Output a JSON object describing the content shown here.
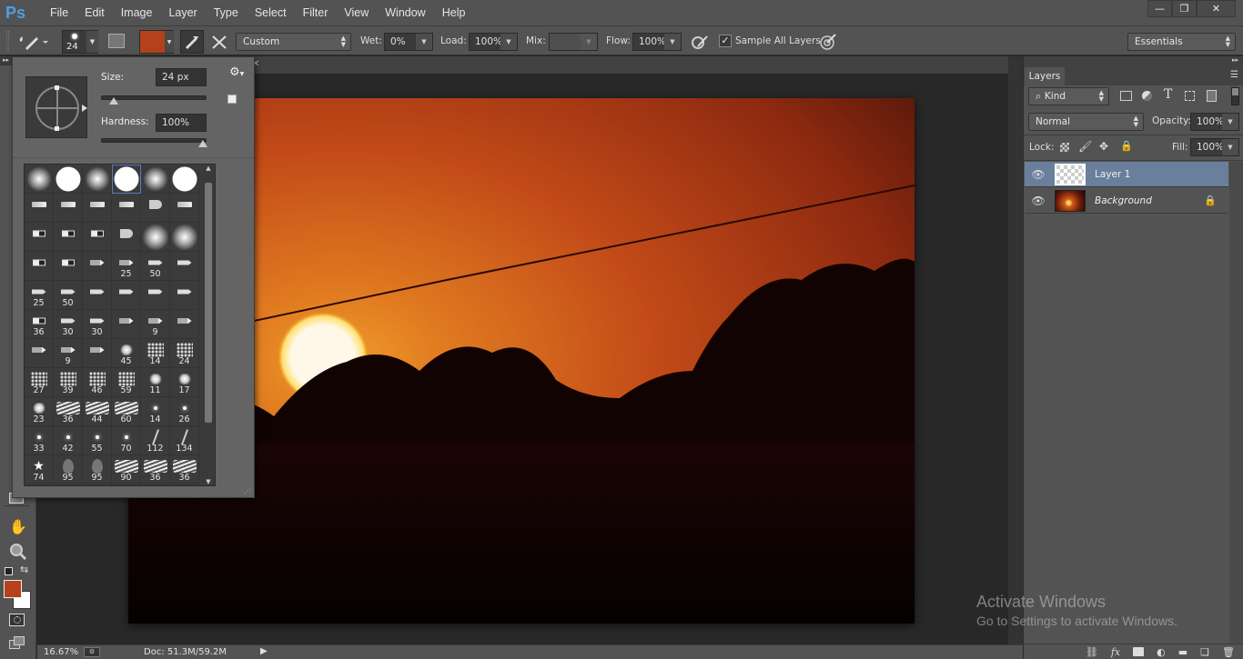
{
  "app": {
    "logo": "Ps"
  },
  "menu": [
    "File",
    "Edit",
    "Image",
    "Layer",
    "Type",
    "Select",
    "Filter",
    "View",
    "Window",
    "Help"
  ],
  "window_controls": {
    "minimize": "—",
    "restore": "❐",
    "close": "✕"
  },
  "options_bar": {
    "brush_size": "24",
    "foreground_color": "#b5411b",
    "preset": "Custom",
    "wet_label": "Wet:",
    "wet_value": "0%",
    "load_label": "Load:",
    "load_value": "100%",
    "mix_label": "Mix:",
    "mix_value": "",
    "flow_label": "Flow:",
    "flow_value": "100%",
    "sample_all_layers_label": "Sample All Layers",
    "sample_all_layers_checked": true,
    "workspace": "Essentials"
  },
  "brush_popup": {
    "size_label": "Size:",
    "size_value": "24 px",
    "size_fraction": 0.08,
    "hardness_label": "Hardness:",
    "hardness_value": "100%",
    "hardness_fraction": 1.0,
    "brushes": [
      {
        "t": "soft",
        "n": ""
      },
      {
        "t": "hard",
        "n": ""
      },
      {
        "t": "soft",
        "n": ""
      },
      {
        "t": "hard",
        "n": "",
        "selected": true
      },
      {
        "t": "soft",
        "n": ""
      },
      {
        "t": "hard",
        "n": ""
      },
      {
        "t": "bristle",
        "n": ""
      },
      {
        "t": "bristle",
        "n": ""
      },
      {
        "t": "bristle",
        "n": ""
      },
      {
        "t": "bristle",
        "n": ""
      },
      {
        "t": "fan",
        "n": ""
      },
      {
        "t": "bristle",
        "n": ""
      },
      {
        "t": "flat",
        "n": ""
      },
      {
        "t": "flat",
        "n": ""
      },
      {
        "t": "flat",
        "n": ""
      },
      {
        "t": "fan",
        "n": ""
      },
      {
        "t": "softbig",
        "n": ""
      },
      {
        "t": "softbig",
        "n": ""
      },
      {
        "t": "flat",
        "n": ""
      },
      {
        "t": "flat",
        "n": ""
      },
      {
        "t": "pencil",
        "n": ""
      },
      {
        "t": "pencil",
        "n": "25"
      },
      {
        "t": "pen",
        "n": "50"
      },
      {
        "t": "pen",
        "n": ""
      },
      {
        "t": "pen",
        "n": "25"
      },
      {
        "t": "pen",
        "n": "50"
      },
      {
        "t": "pen",
        "n": ""
      },
      {
        "t": "pen",
        "n": ""
      },
      {
        "t": "pen",
        "n": ""
      },
      {
        "t": "pen",
        "n": ""
      },
      {
        "t": "flat",
        "n": "36"
      },
      {
        "t": "pen",
        "n": "30"
      },
      {
        "t": "pen",
        "n": "30"
      },
      {
        "t": "pencil",
        "n": ""
      },
      {
        "t": "pencil",
        "n": "9"
      },
      {
        "t": "pencil",
        "n": ""
      },
      {
        "t": "pencil",
        "n": ""
      },
      {
        "t": "pencil",
        "n": "9"
      },
      {
        "t": "pencil",
        "n": ""
      },
      {
        "t": "splat",
        "n": "45"
      },
      {
        "t": "spray",
        "n": "14"
      },
      {
        "t": "spray",
        "n": "24"
      },
      {
        "t": "spray",
        "n": "27"
      },
      {
        "t": "spray",
        "n": "39"
      },
      {
        "t": "spray",
        "n": "46"
      },
      {
        "t": "spray",
        "n": "59"
      },
      {
        "t": "splat",
        "n": "11"
      },
      {
        "t": "splat",
        "n": "17"
      },
      {
        "t": "splat",
        "n": "23"
      },
      {
        "t": "chalk",
        "n": "36"
      },
      {
        "t": "chalk",
        "n": "44"
      },
      {
        "t": "chalk",
        "n": "60"
      },
      {
        "t": "star",
        "n": "14"
      },
      {
        "t": "star",
        "n": "26"
      },
      {
        "t": "star",
        "n": "33"
      },
      {
        "t": "star",
        "n": "42"
      },
      {
        "t": "star",
        "n": "55"
      },
      {
        "t": "star",
        "n": "70"
      },
      {
        "t": "grass",
        "n": "112"
      },
      {
        "t": "grass",
        "n": "134"
      },
      {
        "t": "leaf",
        "n": "74"
      },
      {
        "t": "drop",
        "n": "95"
      },
      {
        "t": "drop",
        "n": "95"
      },
      {
        "t": "chalk",
        "n": "90"
      },
      {
        "t": "chalk",
        "n": "36"
      },
      {
        "t": "chalk",
        "n": "36"
      }
    ]
  },
  "tools": {
    "foreground": "#b5411b",
    "background": "#ffffff"
  },
  "status": {
    "zoom": "16.67%",
    "doc": "Doc: 51.3M/59.2M"
  },
  "layers_panel": {
    "tab": "Layers",
    "filter_kind": "Kind",
    "blend_mode": "Normal",
    "opacity_label": "Opacity:",
    "opacity_value": "100%",
    "lock_label": "Lock:",
    "fill_label": "Fill:",
    "fill_value": "100%",
    "layers": [
      {
        "name": "Layer 1",
        "selected": true,
        "visible": true,
        "locked": false
      },
      {
        "name": "Background",
        "selected": false,
        "visible": true,
        "locked": true
      }
    ]
  },
  "watermark": {
    "title": "Activate Windows",
    "subtitle": "Go to Settings to activate Windows."
  }
}
